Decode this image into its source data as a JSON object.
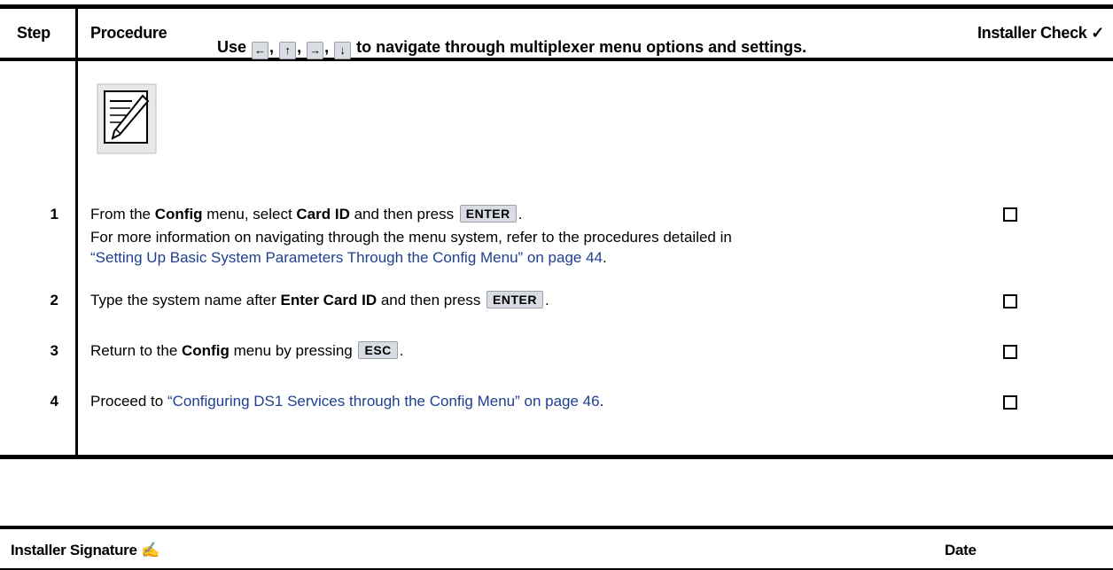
{
  "header": {
    "step": "Step",
    "procedure": "Procedure",
    "installer_check": "Installer Check ✓"
  },
  "note": {
    "use": "Use",
    "sep": ",",
    "text": " to navigate through multiplexer menu options and settings.",
    "arrows": [
      "←",
      "↑",
      "→",
      "↓"
    ]
  },
  "steps": [
    {
      "num": "1",
      "t1": "From the ",
      "b1": "Config",
      "t2": " menu, select ",
      "b2": "Card ID",
      "t3": " and then press ",
      "key": "ENTER",
      "t4": ".",
      "line2": "For more information on navigating through the menu system, refer to the procedures detailed in",
      "link": "“Setting Up Basic System Parameters Through the Config Menu” on page 44",
      "link_end": "."
    },
    {
      "num": "2",
      "t1": "Type the system name after ",
      "b1": "Enter Card ID",
      "t2": " and then press ",
      "key": "ENTER",
      "t3": "."
    },
    {
      "num": "3",
      "t1": "Return to the ",
      "b1": "Config",
      "t2": " menu by pressing ",
      "key": "ESC",
      "t3": "."
    },
    {
      "num": "4",
      "t1": "Proceed to ",
      "link": "“Configuring DS1 Services through the Config Menu” on page 46",
      "t2": "."
    }
  ],
  "signature": {
    "label": "Installer Signature ✍",
    "date": "Date"
  }
}
